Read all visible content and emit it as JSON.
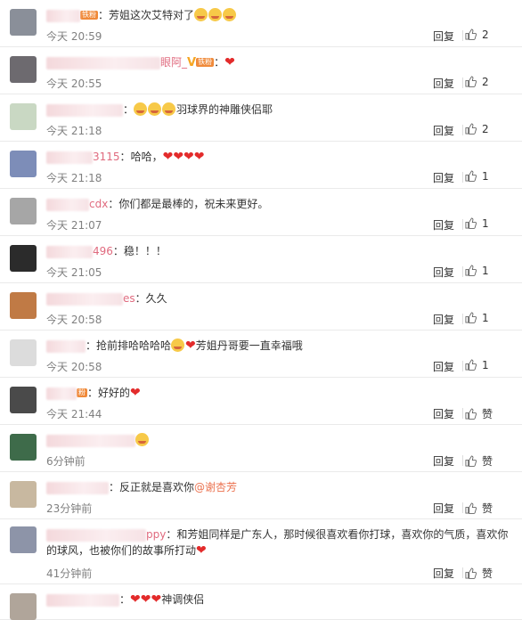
{
  "comments": [
    {
      "name_tail": "",
      "vip": "铁粉",
      "colon": "：",
      "text": "芳姐这次艾特对了",
      "emojis": 3,
      "hearts": 0,
      "suffix": "",
      "time": "今天 20:59",
      "reply": "回复",
      "likes": "2",
      "avatar": "#8a8f99"
    },
    {
      "name_tail": "眼阿_",
      "vip": "铁粉",
      "colon": "：",
      "text": "",
      "emojis": 0,
      "hearts": 1,
      "suffix": "",
      "time": "今天 20:55",
      "reply": "回复",
      "likes": "2",
      "avatar": "#6d6a6f"
    },
    {
      "name_tail": "",
      "vip": "",
      "colon": "：",
      "text": "",
      "emojis": 3,
      "hearts": 0,
      "suffix": "羽球界的神雕侠侣耶",
      "time": "今天 21:18",
      "reply": "回复",
      "likes": "2",
      "avatar": "#c9d8c3"
    },
    {
      "name_tail": "3115",
      "vip": "",
      "colon": "：",
      "text": "哈哈，",
      "emojis": 0,
      "hearts": 4,
      "suffix": "",
      "time": "今天 21:18",
      "reply": "回复",
      "likes": "1",
      "avatar": "#7d8db8"
    },
    {
      "name_tail": "cdx",
      "vip": "",
      "colon": "：",
      "text": "你们都是最棒的，祝未来更好。",
      "emojis": 0,
      "hearts": 0,
      "suffix": "",
      "time": "今天 21:07",
      "reply": "回复",
      "likes": "1",
      "avatar": "#a6a6a6"
    },
    {
      "name_tail": "496",
      "vip": "",
      "colon": "：",
      "text": "稳！！！",
      "emojis": 0,
      "hearts": 0,
      "suffix": "",
      "time": "今天 21:05",
      "reply": "回复",
      "likes": "1",
      "avatar": "#2b2b2b"
    },
    {
      "name_tail": "es",
      "vip": "",
      "colon": "：",
      "text": "久久",
      "emojis": 0,
      "hearts": 0,
      "suffix": "",
      "time": "今天 20:58",
      "reply": "回复",
      "likes": "1",
      "avatar": "#c07a45"
    },
    {
      "name_tail": "",
      "vip": "",
      "colon": "：",
      "text": "抢前排哈哈哈哈",
      "emojis": 1,
      "hearts": 1,
      "suffix": "芳姐丹哥要一直幸福哦",
      "time": "今天 20:58",
      "reply": "回复",
      "likes": "1",
      "avatar": "#dcdcdc"
    },
    {
      "name_tail": "",
      "vip": "粉",
      "colon": "：",
      "text": "好好的",
      "emojis": 0,
      "hearts": 1,
      "suffix": "",
      "time": "今天 21:44",
      "reply": "回复",
      "likes": "赞",
      "avatar": "#4a4a4a"
    },
    {
      "name_tail": "",
      "vip": "",
      "colon": "",
      "text": "",
      "emojis": 1,
      "hearts": 0,
      "suffix": "",
      "time": "6分钟前",
      "reply": "回复",
      "likes": "赞",
      "avatar": "#3e6b4a"
    },
    {
      "name_tail": "",
      "vip": "",
      "colon": "：",
      "text": "反正就是喜欢你",
      "emojis": 0,
      "hearts": 0,
      "suffix": "",
      "mention": "@谢杏芳",
      "time": "23分钟前",
      "reply": "回复",
      "likes": "赞",
      "avatar": "#c8b8a0"
    },
    {
      "name_tail": "ppy",
      "vip": "",
      "colon": "：",
      "text": "和芳姐同样是广东人，那时候很喜欢看你打球，喜欢你的气质，喜欢你的球风，也被你们的故事所打动",
      "emojis": 0,
      "hearts": 1,
      "suffix": "",
      "time": "41分钟前",
      "reply": "回复",
      "likes": "赞",
      "avatar": "#8d94a8"
    },
    {
      "name_tail": "",
      "vip": "",
      "colon": "：",
      "text": "",
      "emojis": 0,
      "hearts": 3,
      "suffix": "神调侠侣",
      "time": "",
      "reply": "",
      "likes": "",
      "avatar": "#b0a59a"
    }
  ]
}
